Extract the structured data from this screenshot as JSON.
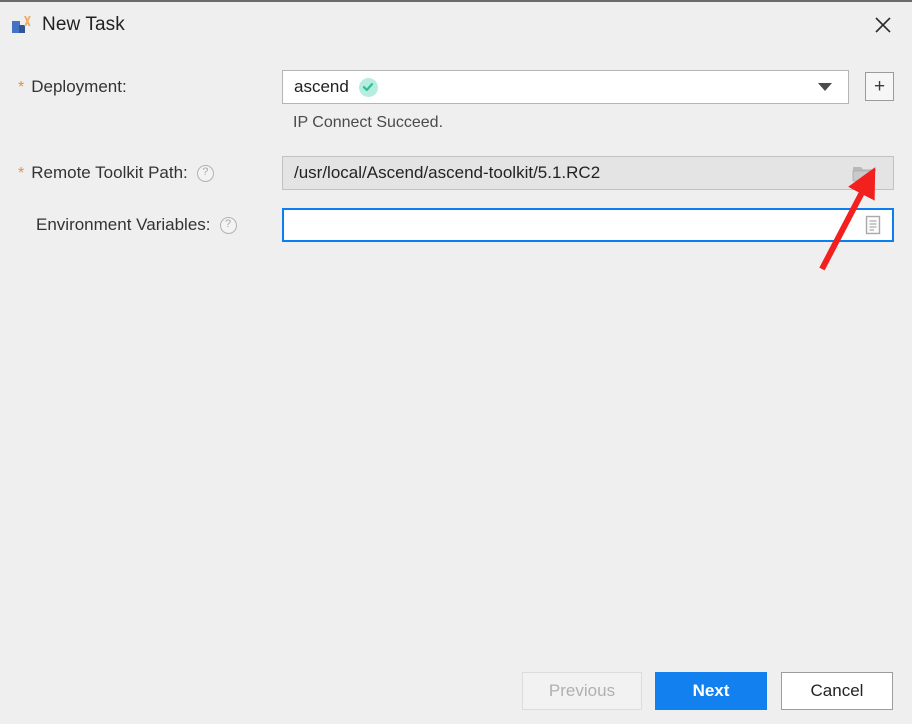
{
  "window": {
    "title": "New Task",
    "app_icon": "chart-bars-icon",
    "close_label": "✕"
  },
  "form": {
    "deployment": {
      "label": "Deployment:",
      "required_marker": "*",
      "value": "ascend",
      "status_icon": "green-check-icon",
      "dropdown_icon": "chevron-down-icon",
      "add_button_label": "+",
      "status_message": "IP Connect Succeed."
    },
    "remote_toolkit_path": {
      "label": "Remote Toolkit Path:",
      "required_marker": "*",
      "help_icon": "help-circle-icon",
      "value": "/usr/local/Ascend/ascend-toolkit/5.1.RC2",
      "browse_icon": "folder-open-icon"
    },
    "environment_variables": {
      "label": "Environment Variables:",
      "help_icon": "help-circle-icon",
      "value": "",
      "placeholder": "",
      "editor_icon": "document-list-icon"
    }
  },
  "footer": {
    "previous_label": "Previous",
    "next_label": "Next",
    "cancel_label": "Cancel"
  },
  "annotation": {
    "arrow": "red-arrow-pointing-to-browse-button"
  },
  "colors": {
    "dialog_background": "#efefef",
    "primary_button": "#1380ef",
    "required_star": "#e8903a",
    "focus_border": "#0a7ff0",
    "success_check": "#3ccfa0",
    "annotation_red": "#f32020"
  }
}
